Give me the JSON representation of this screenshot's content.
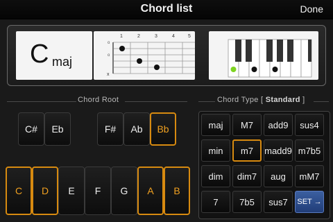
{
  "header": {
    "title": "Chord list",
    "done_label": "Done"
  },
  "chord_display": {
    "root": "C",
    "quality": "maj"
  },
  "fretboard": {
    "fret_numbers": [
      "1",
      "2",
      "3",
      "4",
      "5"
    ],
    "open_markers": [
      "o",
      "o"
    ],
    "mute_marker": "x"
  },
  "sections": {
    "root_label": "Chord Root",
    "type_label_prefix": "Chord Type [ ",
    "type_label_value": "Standard",
    "type_label_suffix": " ]"
  },
  "roots_upper": [
    "C#",
    "Eb",
    "F#",
    "Ab",
    "Bb"
  ],
  "roots_lower": [
    "C",
    "D",
    "E",
    "F",
    "G",
    "A",
    "B"
  ],
  "active_roots": [
    "Bb",
    "C",
    "D",
    "A",
    "B"
  ],
  "chord_types": [
    [
      "maj",
      "M7",
      "add9",
      "sus4"
    ],
    [
      "min",
      "m7",
      "madd9",
      "m7b5"
    ],
    [
      "dim",
      "dim7",
      "aug",
      "mM7"
    ],
    [
      "7",
      "7b5",
      "sus7",
      "SET →"
    ]
  ],
  "selected_type": "m7",
  "colors": {
    "accent": "#d78a10",
    "set_button": "#2f5196",
    "piano_dot_green": "#7ed321"
  }
}
